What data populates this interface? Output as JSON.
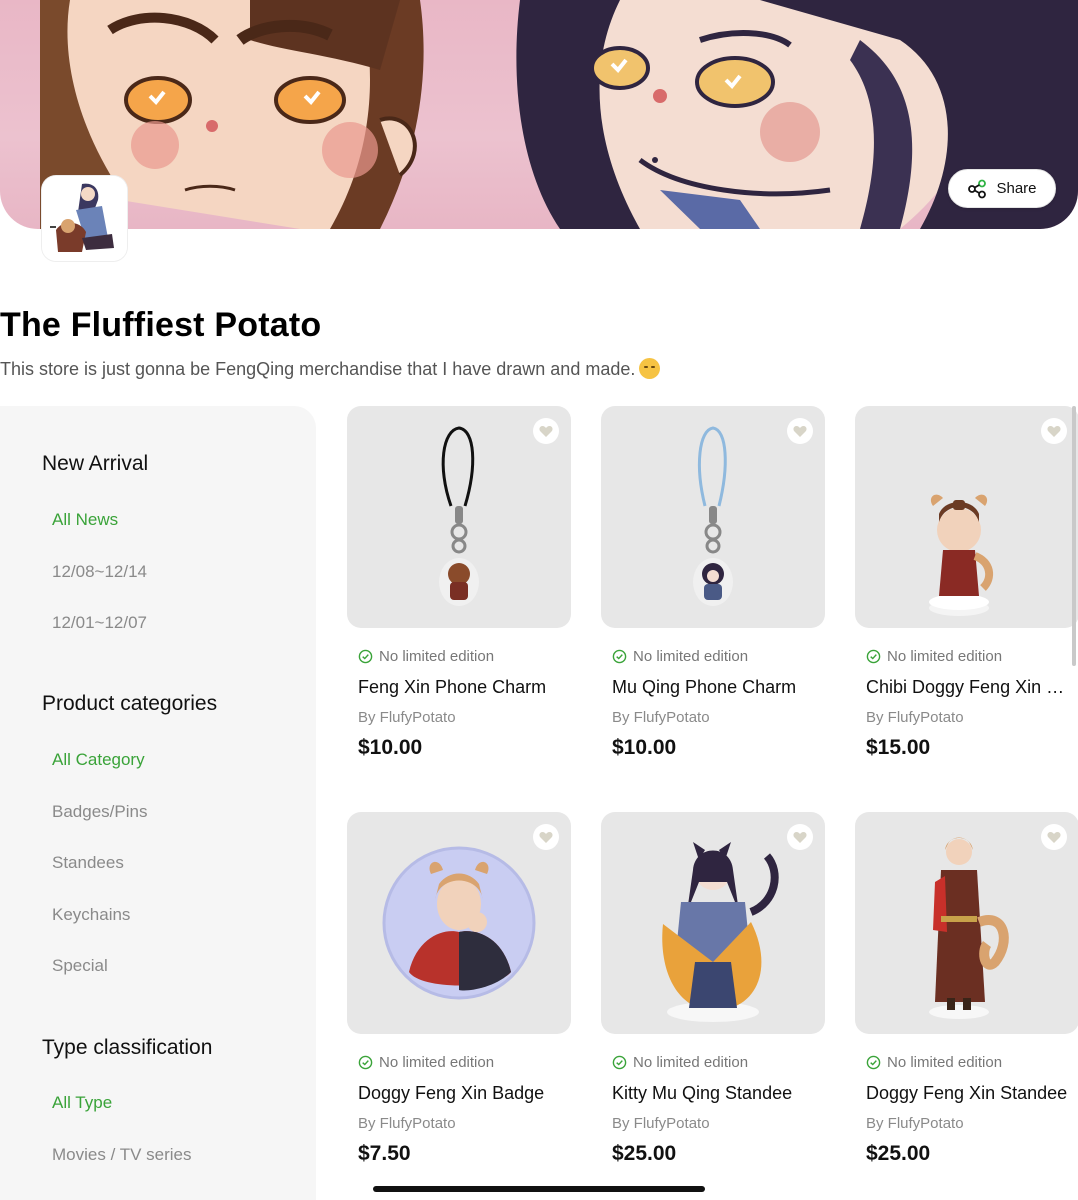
{
  "store": {
    "share_label": "Share",
    "title": "The Fluffiest Potato",
    "description": "This store is just gonna be FengQing merchandise that I have drawn and made."
  },
  "sidebar": {
    "new_arrival": {
      "heading": "New Arrival",
      "items": [
        "All News",
        "12/08~12/14",
        "12/01~12/07"
      ]
    },
    "product_categories": {
      "heading": "Product categories",
      "items": [
        "All Category",
        "Badges/Pins",
        "Standees",
        "Keychains",
        "Special"
      ]
    },
    "type_classification": {
      "heading": "Type classification",
      "items": [
        "All Type",
        "Movies / TV series"
      ]
    }
  },
  "products": [
    {
      "edition": "No limited edition",
      "name": "Feng Xin Phone Charm",
      "by": "By FlufyPotato",
      "price": "$10.00"
    },
    {
      "edition": "No limited edition",
      "name": "Mu Qing Phone Charm",
      "by": "By FlufyPotato",
      "price": "$10.00"
    },
    {
      "edition": "No limited edition",
      "name": "Chibi Doggy Feng Xin Standee",
      "by": "By FlufyPotato",
      "price": "$15.00"
    },
    {
      "edition": "No limited edition",
      "name": "Doggy Feng Xin Badge",
      "by": "By FlufyPotato",
      "price": "$7.50"
    },
    {
      "edition": "No limited edition",
      "name": "Kitty Mu Qing Standee",
      "by": "By FlufyPotato",
      "price": "$25.00"
    },
    {
      "edition": "No limited edition",
      "name": "Doggy Feng Xin Standee",
      "by": "By FlufyPotato",
      "price": "$25.00"
    }
  ],
  "colors": {
    "accent_green": "#3aa339",
    "banner_pink": "#e9b7c6",
    "card_bg": "#e7e7e7",
    "sidebar_bg": "#f6f6f6"
  },
  "icons": {
    "share": "share-icon",
    "heart": "heart-icon",
    "check": "check-circle-icon",
    "emoji": "kissing-face-emoji"
  }
}
